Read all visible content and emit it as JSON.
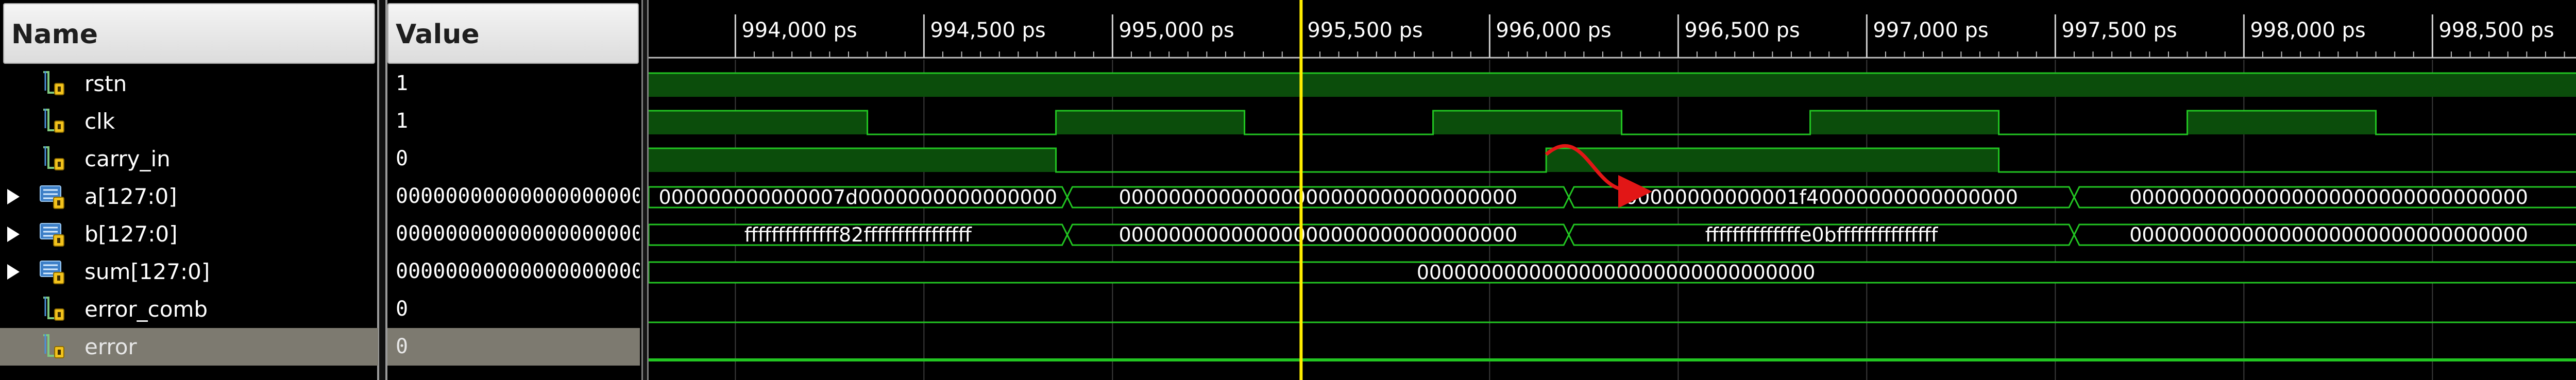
{
  "headers": {
    "name": "Name",
    "value": "Value"
  },
  "signals": [
    {
      "name": "rstn",
      "value": "1",
      "kind": "bit",
      "expandable": false,
      "icon": "scalar-signal-icon"
    },
    {
      "name": "clk",
      "value": "1",
      "kind": "bit",
      "expandable": false,
      "icon": "scalar-signal-icon"
    },
    {
      "name": "carry_in",
      "value": "0",
      "kind": "bit",
      "expandable": false,
      "icon": "scalar-signal-icon"
    },
    {
      "name": "a[127:0]",
      "value": "00000000000000000000",
      "kind": "bus",
      "expandable": true,
      "icon": "bus-signal-icon"
    },
    {
      "name": "b[127:0]",
      "value": "00000000000000000000",
      "kind": "bus",
      "expandable": true,
      "icon": "bus-signal-icon"
    },
    {
      "name": "sum[127:0]",
      "value": "00000000000000000000",
      "kind": "bus",
      "expandable": true,
      "icon": "bus-signal-icon"
    },
    {
      "name": "error_comb",
      "value": "0",
      "kind": "bit",
      "expandable": false,
      "icon": "scalar-signal-icon"
    },
    {
      "name": "error",
      "value": "0",
      "kind": "bit",
      "expandable": false,
      "icon": "scalar-signal-icon",
      "selected": true
    }
  ],
  "timeline": {
    "tick_labels": [
      "994,000 ps",
      "994,500 ps",
      "995,000 ps",
      "995,500 ps",
      "996,000 ps",
      "996,500 ps",
      "997,000 ps",
      "997,500 ps",
      "998,000 ps",
      "998,500 ps"
    ],
    "cursor_ps": 995500
  },
  "waves": {
    "rstn": {
      "high_all": true
    },
    "clk": {
      "edges_ps": [
        994350,
        994850,
        995350,
        995850,
        996350,
        996850,
        997350,
        997850,
        998350
      ],
      "start_level": 1
    },
    "carry_in": {
      "edges_ps": [
        994850,
        996150,
        997350
      ],
      "start_level": 1
    },
    "a": {
      "segments": [
        {
          "from_ps": 993770,
          "to_ps": 994880,
          "label": "000000000000007d0000000000000000"
        },
        {
          "from_ps": 994880,
          "to_ps": 996210,
          "label": "00000000000000000000000000000000"
        },
        {
          "from_ps": 996210,
          "to_ps": 997550,
          "label": "00000000000001f40000000000000000"
        },
        {
          "from_ps": 997550,
          "to_ps": 998900,
          "label": "00000000000000000000000000000000"
        }
      ]
    },
    "b": {
      "segments": [
        {
          "from_ps": 993770,
          "to_ps": 994880,
          "label": "ffffffffffffff82ffffffffffffffff"
        },
        {
          "from_ps": 994880,
          "to_ps": 996210,
          "label": "00000000000000000000000000000000"
        },
        {
          "from_ps": 996210,
          "to_ps": 997550,
          "label": "ffffffffffffffe0bfffffffffffffff"
        },
        {
          "from_ps": 997550,
          "to_ps": 998900,
          "label": "00000000000000000000000000000000"
        }
      ]
    },
    "sum": {
      "segments": [
        {
          "from_ps": 993770,
          "to_ps": 998900,
          "label": "00000000000000000000000000000000"
        }
      ]
    },
    "error_comb": {
      "high_all": false
    },
    "error": {
      "high_all": false
    }
  },
  "colors": {
    "wave_green": "#22c522",
    "high_fill": "#0b4d0b",
    "cursor": "#ffee00",
    "grid": "#3a3a3a",
    "annotation_red": "#e21616"
  }
}
